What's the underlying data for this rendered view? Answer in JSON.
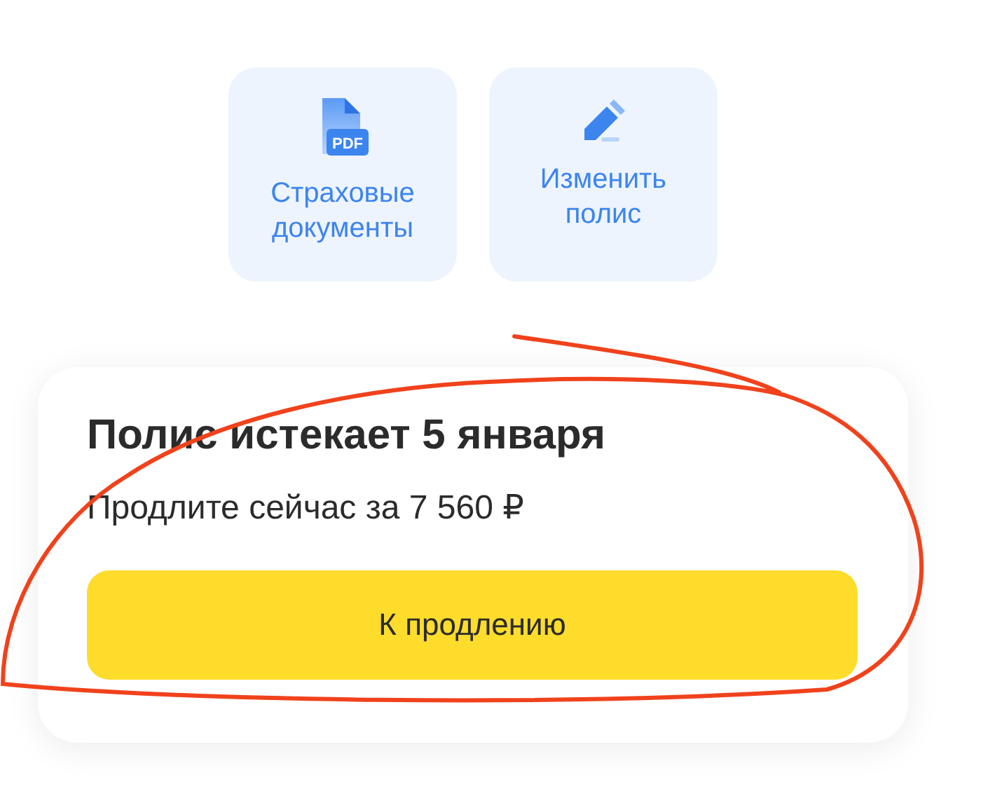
{
  "actions": [
    {
      "kind": "pdf",
      "label": "Страховые документы",
      "icon_label": "PDF"
    },
    {
      "kind": "edit",
      "label": "Изменить полис"
    }
  ],
  "renewal_card": {
    "title": "Полис истекает 5 января",
    "subtitle": "Продлите сейчас за 7 560 ₽",
    "button": "К продлению"
  },
  "annotation": {
    "kind": "scribble"
  }
}
